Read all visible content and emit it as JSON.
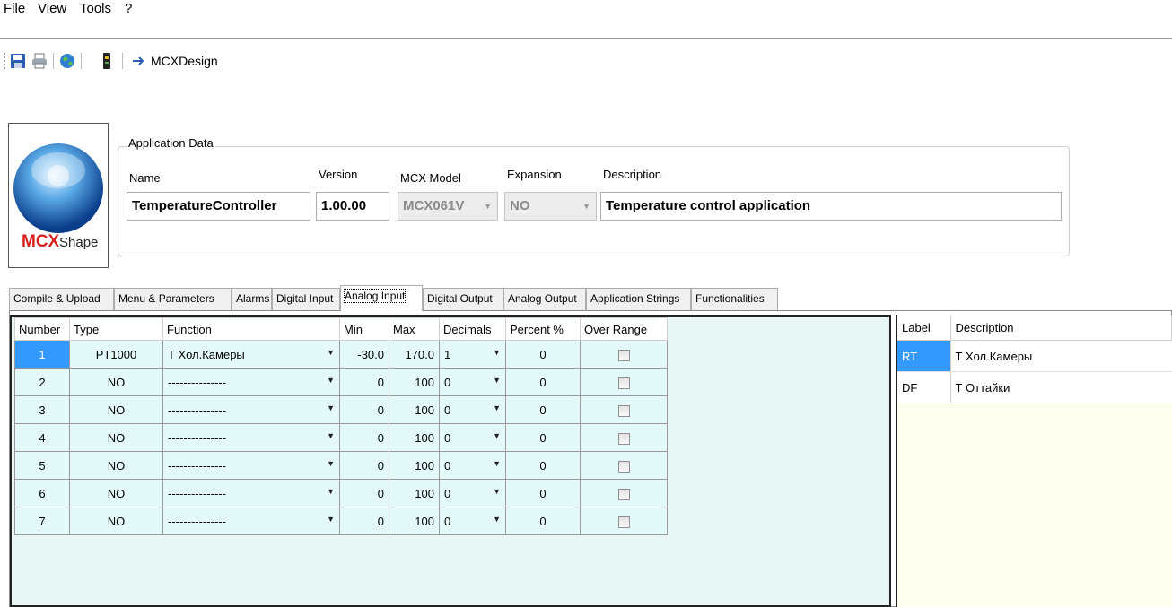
{
  "menu": [
    "File",
    "View",
    "Tools",
    "?"
  ],
  "toolbar": {
    "label": "MCXDesign",
    "icons": [
      "save-icon",
      "print-icon",
      "globe-icon",
      "device-icon",
      "arrow-right-icon"
    ]
  },
  "logo": {
    "text_mcx": "MCX",
    "text_shape": "Shape"
  },
  "app_data": {
    "title": "Application Data",
    "name_label": "Name",
    "name": "TemperatureController",
    "version_label": "Version",
    "version": "1.00.00",
    "model_label": "MCX Model",
    "model": "MCX061V",
    "expansion_label": "Expansion",
    "expansion": "NO",
    "description_label": "Description",
    "description": "Temperature control application"
  },
  "tabs": [
    "Compile & Upload",
    "Menu & Parameters",
    "Alarms",
    "Digital Input",
    "Analog Input",
    "Digital Output",
    "Analog Output",
    "Application Strings",
    "Functionalities"
  ],
  "active_tab": "Analog Input",
  "grid": {
    "headers": [
      "Number",
      "Type",
      "Function",
      "Min",
      "Max",
      "Decimals",
      "Percent %",
      "Over Range"
    ],
    "rows": [
      {
        "number": "1",
        "type": "PT1000",
        "function": "Т Хол.Камеры",
        "min": "-30.0",
        "max": "170.0",
        "decimals": "1",
        "percent": "0"
      },
      {
        "number": "2",
        "type": "NO",
        "function": "---------------",
        "min": "0",
        "max": "100",
        "decimals": "0",
        "percent": "0"
      },
      {
        "number": "3",
        "type": "NO",
        "function": "---------------",
        "min": "0",
        "max": "100",
        "decimals": "0",
        "percent": "0"
      },
      {
        "number": "4",
        "type": "NO",
        "function": "---------------",
        "min": "0",
        "max": "100",
        "decimals": "0",
        "percent": "0"
      },
      {
        "number": "5",
        "type": "NO",
        "function": "---------------",
        "min": "0",
        "max": "100",
        "decimals": "0",
        "percent": "0"
      },
      {
        "number": "6",
        "type": "NO",
        "function": "---------------",
        "min": "0",
        "max": "100",
        "decimals": "0",
        "percent": "0"
      },
      {
        "number": "7",
        "type": "NO",
        "function": "---------------",
        "min": "0",
        "max": "100",
        "decimals": "0",
        "percent": "0"
      }
    ]
  },
  "side": {
    "headers": [
      "Label",
      "Description"
    ],
    "rows": [
      {
        "label": "RT",
        "description": "Т Хол.Камеры"
      },
      {
        "label": "DF",
        "description": "Т Оттайки"
      }
    ]
  },
  "colors": {
    "selection": "#3399ff",
    "grid_bg": "#e9f7f7",
    "side_bg": "#fffff0"
  }
}
